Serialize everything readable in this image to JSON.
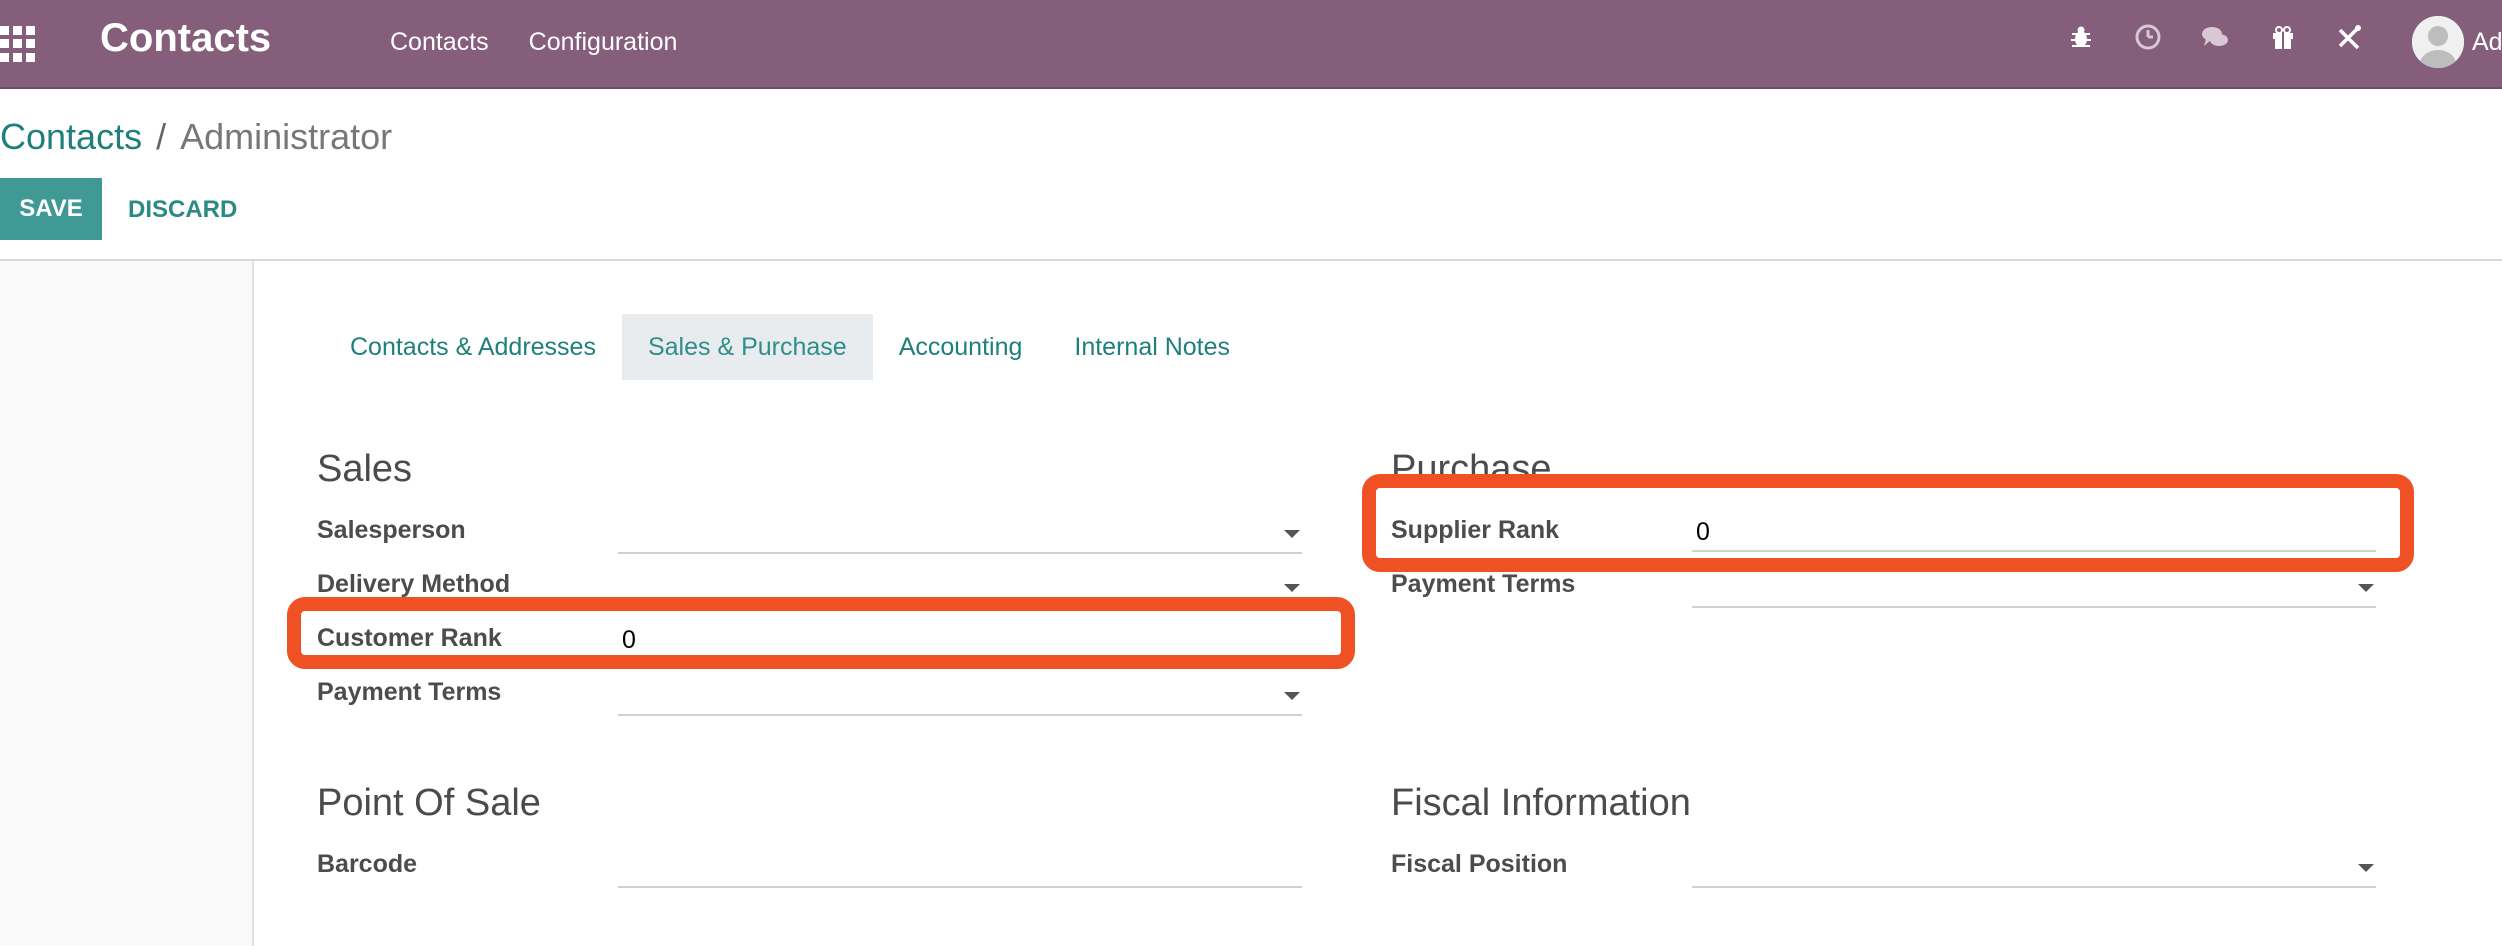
{
  "navbar": {
    "apps_icon": "grid-icon",
    "brand": "Contacts",
    "menu": [
      "Contacts",
      "Configuration"
    ],
    "systray_icons": [
      "bug-icon",
      "clock-icon",
      "chat-icon",
      "gift-icon",
      "tools-icon"
    ],
    "user_name": "Ad"
  },
  "breadcrumb": {
    "parent": "Contacts",
    "separator": "/",
    "current": "Administrator"
  },
  "actions": {
    "save": "SAVE",
    "discard": "DISCARD"
  },
  "tabs": [
    {
      "label": "Contacts & Addresses",
      "active": false
    },
    {
      "label": "Sales & Purchase",
      "active": true
    },
    {
      "label": "Accounting",
      "active": false
    },
    {
      "label": "Internal Notes",
      "active": false
    }
  ],
  "sales": {
    "title": "Sales",
    "salesperson_label": "Salesperson",
    "salesperson_value": "",
    "delivery_method_label": "Delivery Method",
    "delivery_method_value": "",
    "customer_rank_label": "Customer Rank",
    "customer_rank_value": "0",
    "payment_terms_label": "Payment Terms",
    "payment_terms_value": ""
  },
  "purchase": {
    "title": "Purchase",
    "supplier_rank_label": "Supplier Rank",
    "supplier_rank_value": "0",
    "payment_terms_label": "Payment Terms",
    "payment_terms_value": ""
  },
  "pos": {
    "title": "Point Of Sale",
    "barcode_label": "Barcode",
    "barcode_value": ""
  },
  "fiscal": {
    "title": "Fiscal Information",
    "fiscal_position_label": "Fiscal Position",
    "fiscal_position_value": ""
  },
  "colors": {
    "navbar": "#845e7b",
    "accent": "#3f9a96",
    "link": "#1f7f7a",
    "highlight": "#ef5124"
  }
}
